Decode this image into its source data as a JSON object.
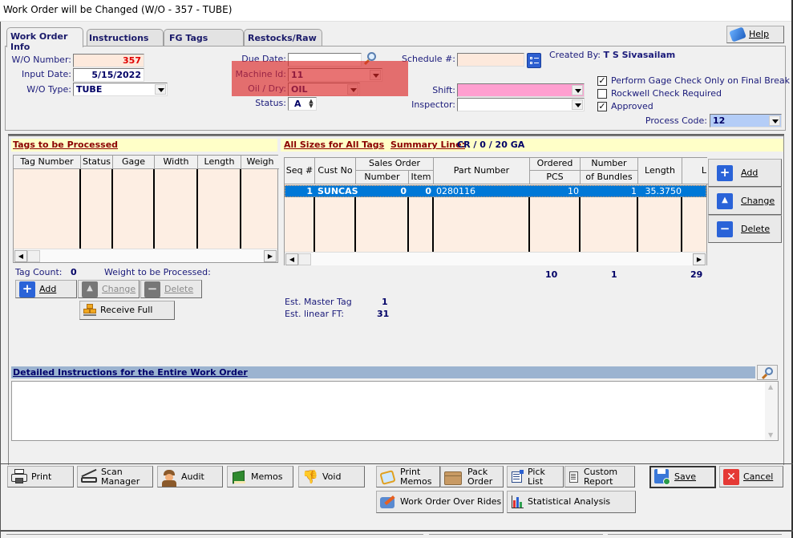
{
  "window": {
    "title": "Work Order will be Changed  (W/O - 357 - TUBE)"
  },
  "tabs": [
    {
      "label": "Work Order Info",
      "active": true
    },
    {
      "label": "Instructions",
      "active": false
    },
    {
      "label": "FG Tags",
      "active": false
    },
    {
      "label": "Restocks/Raw",
      "active": false
    }
  ],
  "help_button": {
    "label": "Help",
    "icon": "help-book-icon"
  },
  "form": {
    "wo_number": {
      "label": "W/O Number:",
      "value": "357"
    },
    "input_date": {
      "label": "Input Date:",
      "value": "5/15/2022"
    },
    "wo_type": {
      "label": "W/O Type:",
      "value": "TUBE"
    },
    "due_date": {
      "label": "Due Date:",
      "value": ""
    },
    "machine_id": {
      "label": "Machine Id:",
      "value": "11"
    },
    "oil_dry": {
      "label": "Oil / Dry:",
      "value": "OIL"
    },
    "status": {
      "label": "Status:",
      "value": "A"
    },
    "schedule": {
      "label": "Schedule #:",
      "value": ""
    },
    "created_by": {
      "label": "Created By:",
      "value": "T S Sivasailam"
    },
    "shift": {
      "label": "Shift:",
      "value": ""
    },
    "inspector": {
      "label": "Inspector:",
      "value": ""
    },
    "process_code": {
      "label": "Process Code:",
      "value": "12"
    },
    "checkboxes": [
      {
        "label": "Perform Gage Check Only on Final Break",
        "checked": true
      },
      {
        "label": "Rockwell Check Required",
        "checked": false
      },
      {
        "label": "Approved",
        "checked": true
      }
    ]
  },
  "tags_panel": {
    "title": "Tags to be Processed",
    "columns": [
      "Tag Number",
      "Status",
      "Gage",
      "Width",
      "Length",
      "Weigh"
    ],
    "rows": [],
    "tag_count_label": "Tag Count:",
    "tag_count": "0",
    "weight_label": "Weight to be Processed:",
    "weight_value": "",
    "buttons": {
      "add": "Add",
      "change": "Change",
      "delete": "Delete",
      "receive_full": "Receive Full"
    }
  },
  "sizes_panel": {
    "title": "All Sizes for All Tags",
    "summary_label": "Summary Line:",
    "summary_value": "CR / 0 / 20 GA",
    "columns": {
      "seq": "Seq #",
      "cust_no": "Cust No",
      "sales_order": "Sales Order",
      "so_number": "Number",
      "so_item": "Item",
      "part_number": "Part Number",
      "ordered": "Ordered",
      "pcs": "PCS",
      "number": "Number",
      "of_bundles": "of Bundles",
      "length": "Length",
      "l_more": "L"
    },
    "rows": [
      {
        "seq": "1",
        "cust_no": "SUNCAS",
        "so_number": "0",
        "so_item": "0",
        "part_number": "0280116",
        "pcs": "10",
        "bundles": "1",
        "length": "35.3750"
      }
    ],
    "totals": {
      "pcs": "10",
      "bundles": "1",
      "extra": "29"
    },
    "buttons": {
      "add": "Add",
      "change": "Change",
      "delete": "Delete"
    },
    "est_master_tag_label": "Est. Master Tag",
    "est_master_tag": "1",
    "est_linear_ft_label": "Est. linear FT:",
    "est_linear_ft": "31"
  },
  "instructions": {
    "title": "Detailed Instructions for the Entire Work Order",
    "value": ""
  },
  "toolbar": {
    "print": "Print",
    "scan_manager_1": "Scan",
    "scan_manager_2": "Manager",
    "audit": "Audit",
    "memos": "Memos",
    "void": "Void",
    "print_memos_1": "Print",
    "print_memos_2": "Memos",
    "pack_order_1": "Pack",
    "pack_order_2": "Order",
    "pick_list": "Pick List",
    "custom_report_1": "Custom",
    "custom_report_2": "Report",
    "save": "Save",
    "cancel": "Cancel",
    "wo_overrides": "Work Order Over Rides",
    "stat_analysis": "Statistical Analysis"
  },
  "colors": {
    "highlight": "#dc2828",
    "selected_row": "#0078d7",
    "grid_bg": "#fdeee3",
    "header_bar": "#ffffc8",
    "instructions_bar": "#9bb3d0"
  }
}
